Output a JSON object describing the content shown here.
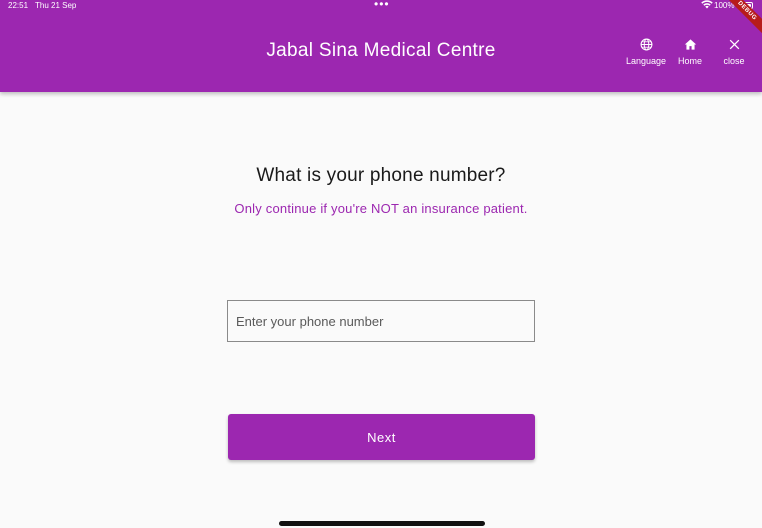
{
  "status_bar": {
    "time": "22:51",
    "date": "Thu 21 Sep",
    "dots": "•••",
    "battery": "100%"
  },
  "app_bar": {
    "title": "Jabal Sina Medical Centre",
    "actions": {
      "language": {
        "label": "Language",
        "icon": "globe-icon"
      },
      "home": {
        "label": "Home",
        "icon": "home-icon"
      },
      "close": {
        "label": "close",
        "icon": "close-icon"
      }
    },
    "color": "#9c27b0"
  },
  "debug_banner": "DEBUG",
  "main": {
    "question": "What is your phone number?",
    "notice": "Only continue if you're NOT an insurance patient.",
    "phone_input": {
      "placeholder": "Enter your phone number",
      "value": ""
    },
    "next_button": "Next"
  },
  "colors": {
    "accent": "#9c27b0",
    "background": "#fafafa",
    "text": "#1a1a1a"
  }
}
